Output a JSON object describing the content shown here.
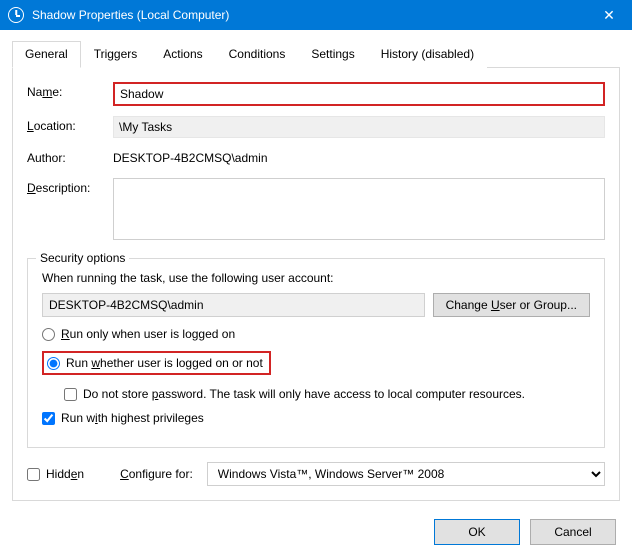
{
  "window": {
    "title": "Shadow Properties (Local Computer)",
    "close": "✕"
  },
  "tabs": {
    "general": "General",
    "triggers": "Triggers",
    "actions": "Actions",
    "conditions": "Conditions",
    "settings": "Settings",
    "history": "History (disabled)"
  },
  "labels": {
    "name_pre": "Na",
    "name_u": "m",
    "name_post": "e:",
    "location_u": "L",
    "location_post": "ocation:",
    "author": "Author:",
    "description_u": "D",
    "description_post": "escription:",
    "security_legend": "Security options",
    "sec_text": "When running the task, use the following user account:",
    "change_user_pre": "Change ",
    "change_user_u": "U",
    "change_user_post": "ser or Group...",
    "run_logged_pre": "",
    "run_logged_u": "R",
    "run_logged_post": "un only when user is logged on",
    "run_whether_pre": "Run ",
    "run_whether_u": "w",
    "run_whether_post": "hether user is logged on or not",
    "no_pass_pre": "Do not store ",
    "no_pass_u": "p",
    "no_pass_post": "assword.  The task will only have access to local computer resources.",
    "highest_pre": "Run w",
    "highest_u": "i",
    "highest_post": "th highest privileges",
    "hidden_pre": "Hidd",
    "hidden_u": "e",
    "hidden_post": "n",
    "configure_pre": "",
    "configure_u": "C",
    "configure_post": "onfigure for:",
    "ok": "OK",
    "cancel": "Cancel"
  },
  "values": {
    "name": "Shadow",
    "location": "\\My Tasks",
    "author": "DESKTOP-4B2CMSQ\\admin",
    "description": "",
    "account": "DESKTOP-4B2CMSQ\\admin",
    "configure_for": "Windows Vista™, Windows Server™ 2008"
  },
  "state": {
    "run_option": "whether",
    "no_store_pass": false,
    "highest_priv": true,
    "hidden": false
  }
}
